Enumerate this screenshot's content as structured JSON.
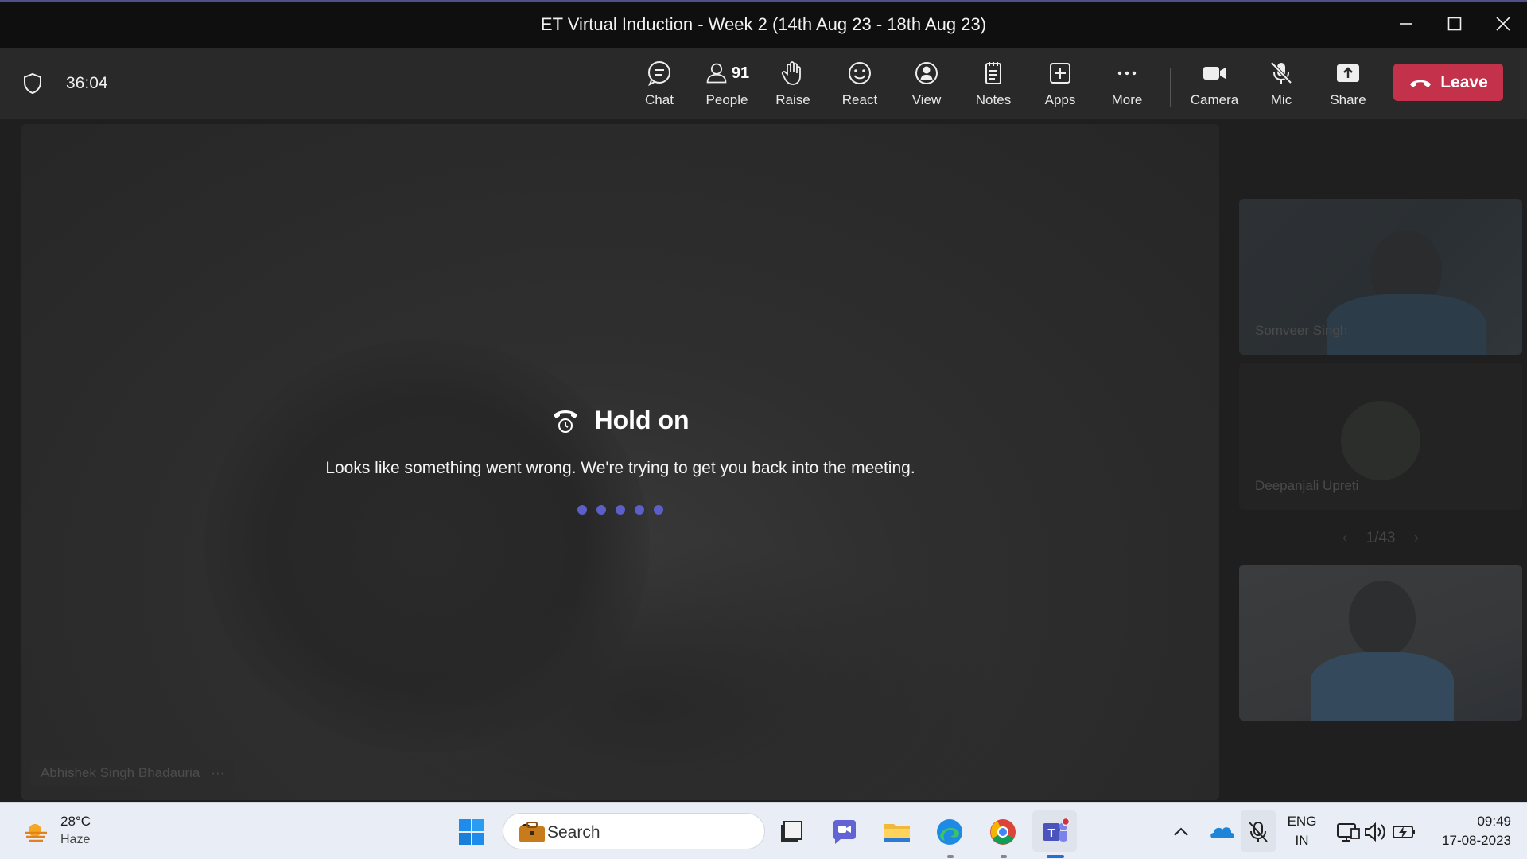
{
  "window": {
    "title": "ET Virtual Induction - Week 2 (14th Aug 23 - 18th Aug 23)"
  },
  "toolbar": {
    "timer": "36:04",
    "buttons": [
      {
        "id": "chat",
        "label": "Chat",
        "icon": "chat-icon"
      },
      {
        "id": "people",
        "label": "People",
        "icon": "people-icon",
        "count": "91"
      },
      {
        "id": "raise",
        "label": "Raise",
        "icon": "raise-hand-icon"
      },
      {
        "id": "react",
        "label": "React",
        "icon": "smiley-icon"
      },
      {
        "id": "view",
        "label": "View",
        "icon": "view-icon"
      },
      {
        "id": "notes",
        "label": "Notes",
        "icon": "notes-icon"
      },
      {
        "id": "apps",
        "label": "Apps",
        "icon": "plus-square-icon"
      },
      {
        "id": "more",
        "label": "More",
        "icon": "more-dots-icon"
      },
      {
        "id": "camera",
        "label": "Camera",
        "icon": "camera-icon"
      },
      {
        "id": "mic",
        "label": "Mic",
        "icon": "mic-off-icon"
      },
      {
        "id": "share",
        "label": "Share",
        "icon": "share-icon"
      }
    ],
    "leave_label": "Leave"
  },
  "stage": {
    "speaker_name": "Abhishek Singh Bhadauria",
    "speaker_more": "···",
    "hold_title": "Hold on",
    "hold_message": "Looks like something went wrong. We're trying to get you back into the meeting."
  },
  "gallery": {
    "tiles": [
      {
        "name": "Somveer Singh"
      },
      {
        "name": "Deepanjali Upreti"
      },
      {
        "name": ""
      }
    ],
    "pager": "1/43"
  },
  "taskbar": {
    "weather_temp": "28°C",
    "weather_cond": "Haze",
    "search_label": "Search",
    "lang_top": "ENG",
    "lang_bottom": "IN",
    "time": "09:49",
    "date": "17-08-2023"
  },
  "colors": {
    "accent": "#5b5fc7",
    "leave": "#c4314b",
    "toolbar": "#292929",
    "titlebar": "#0f0f0f"
  }
}
